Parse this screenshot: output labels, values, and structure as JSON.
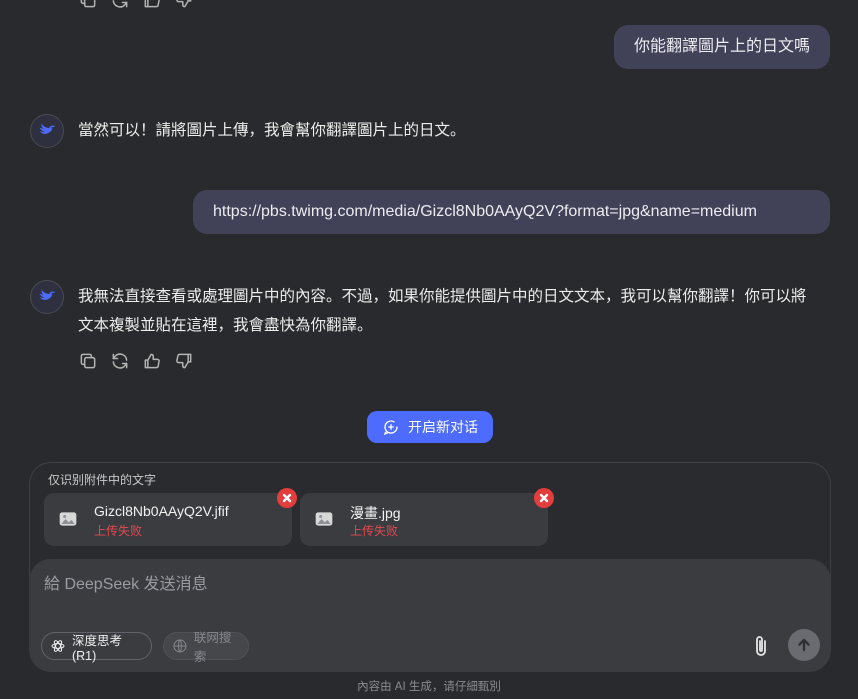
{
  "messages": [
    {
      "role": "user",
      "text": "你能翻譯圖片上的日文嗎"
    },
    {
      "role": "assistant",
      "text": "當然可以！請將圖片上傳，我會幫你翻譯圖片上的日文。"
    },
    {
      "role": "user",
      "text": "https://pbs.twimg.com/media/Gizcl8Nb0AAyQ2V?format=jpg&name=medium"
    },
    {
      "role": "assistant",
      "lines": [
        "我無法直接查看或處理圖片中的內容。不過，如果你能提供圖片中的日文文本，我可以幫你翻譯！你可以將",
        "文本複製並貼在這裡，我會盡快為你翻譯。"
      ]
    }
  ],
  "new_chat": {
    "label": "开启新对话"
  },
  "attachments": {
    "title": "仅识别附件中的文字",
    "files": [
      {
        "name": "Gizcl8Nb0AAyQ2V.jfif",
        "status": "上传失败"
      },
      {
        "name": "漫畫.jpg",
        "status": "上传失败"
      }
    ]
  },
  "composer": {
    "placeholder": "給 DeepSeek 发送消息",
    "deep_think_label": "深度思考 (R1)",
    "web_search_label": "联网搜索"
  },
  "footer": {
    "note": "內容由 AI 生成，请仔細甄別"
  },
  "colors": {
    "accent": "#4d6bfe",
    "error": "#e43d3d"
  }
}
